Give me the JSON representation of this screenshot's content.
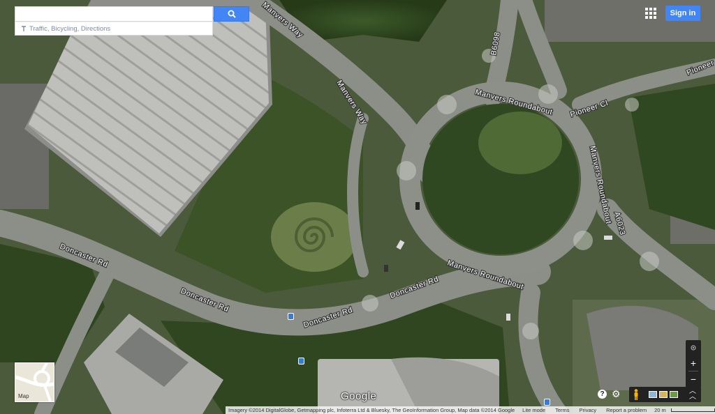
{
  "search": {
    "placeholder": "",
    "value": ""
  },
  "subpanel": {
    "text": "Traffic, Bicycling, Directions"
  },
  "header": {
    "signin_label": "Sign in"
  },
  "roads": {
    "manvers_way_top": "Manvers Way",
    "manvers_way": "Manvers Way",
    "b6098": "B6098",
    "roundabout_top": "Manvers Roundabout",
    "pioneer_cl": "Pioneer Cl",
    "pioneer_cl_edge": "Pioneer Cl",
    "roundabout_right": "Manvers Roundabout",
    "a6023": "A6023",
    "roundabout_bottom": "Manvers Roundabout",
    "doncaster_rd_1": "Doncaster Rd",
    "doncaster_rd_2": "Doncaster Rd",
    "doncaster_rd_3": "Doncaster Rd",
    "doncaster_rd_4": "Doncaster Rd"
  },
  "minimap": {
    "label": "Map"
  },
  "zoom": {
    "plus": "+",
    "minus": "−"
  },
  "help": {
    "label": "?"
  },
  "logo": {
    "text": "Google"
  },
  "attribution": {
    "imagery": "Imagery ©2014 DigitalGlobe, Getmapping plc, Infoterra Ltd & Bluesky, The GeoInformation Group, Map data ©2014 Google",
    "lite_mode": "Lite mode",
    "terms": "Terms",
    "privacy": "Privacy",
    "report": "Report a problem",
    "scale": "20 m"
  },
  "colors": {
    "accent": "#4285f4",
    "road": "#8a8e86",
    "grass": "#4f6b33",
    "trees": "#2d4420"
  }
}
